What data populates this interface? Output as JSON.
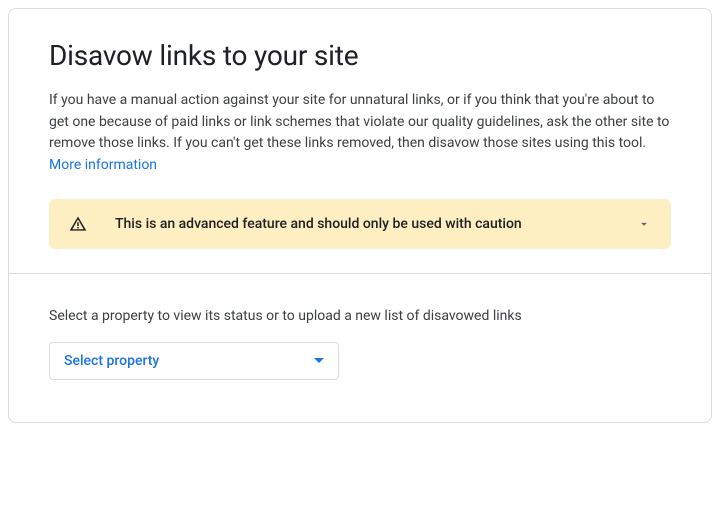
{
  "header": {
    "title": "Disavow links to your site",
    "description": "If you have a manual action against your site for unnatural links, or if you think that you're about to get one because of paid links or link schemes that violate our quality guidelines, ask the other site to remove those links. If you can't get these links removed, then disavow those sites using this tool.",
    "more_info_link": "More information"
  },
  "warning": {
    "text": "This is an advanced feature and should only be used with caution"
  },
  "property_section": {
    "label": "Select a property to view its status or to upload a new list of disavowed links",
    "dropdown_text": "Select property"
  }
}
